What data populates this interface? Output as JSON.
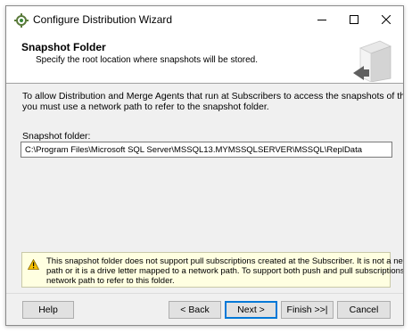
{
  "window": {
    "title": "Configure Distribution Wizard",
    "controls": [
      "minimize",
      "maximize",
      "close"
    ]
  },
  "header": {
    "title": "Snapshot Folder",
    "subtitle": "Specify the root location where snapshots will be stored."
  },
  "intro": {
    "line1": "To allow Distribution and Merge Agents that run at Subscribers to access the snapshots of their publications,",
    "line2": "you must use a network path to refer to the snapshot folder."
  },
  "snapshot_folder": {
    "label": "Snapshot folder:",
    "value": "C:\\Program Files\\Microsoft SQL Server\\MSSQL13.MYMSSQLSERVER\\MSSQL\\ReplData"
  },
  "warning": {
    "icon": "warning-icon",
    "line1": "This snapshot folder does not support pull subscriptions created at the Subscriber. It is not a network",
    "line2": "path or it is a drive letter mapped to a network path. To support both push and pull subscriptions, use a",
    "line3": "network path to refer to this folder."
  },
  "buttons": {
    "help": "Help",
    "back": "< Back",
    "next": "Next >",
    "finish": "Finish >>|",
    "cancel": "Cancel"
  },
  "colors": {
    "dialog_bg": "#f0f0f0",
    "warning_bg": "#ffffe1",
    "accent": "#0078d7"
  }
}
